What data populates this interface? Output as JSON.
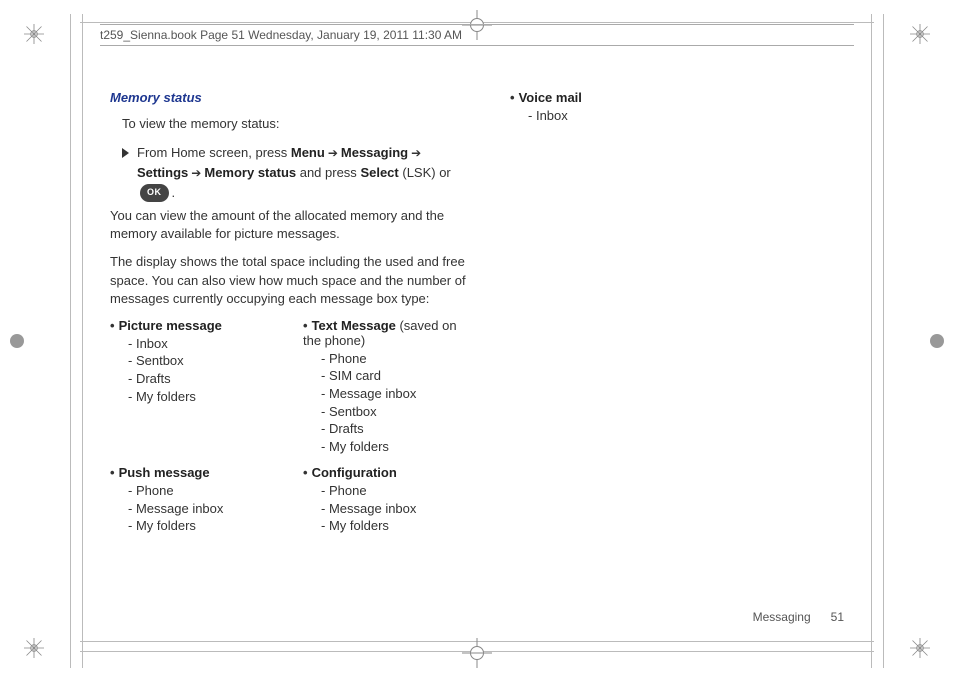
{
  "frame": {
    "header": "t259_Sienna.book  Page 51  Wednesday, January 19, 2011  11:30 AM"
  },
  "section": {
    "title": "Memory status",
    "intro": "To view the memory status:",
    "step": {
      "pre": "From Home screen, press ",
      "menu": "Menu",
      "arr": "➔",
      "messaging": "Messaging",
      "settings": "Settings",
      "memstatus": "Memory status",
      "and_press": " and press ",
      "select": "Select",
      "lsk": " (LSK) or ",
      "ok": "OK",
      "dot": "."
    },
    "para1": "You can view the amount of the allocated memory and the memory available for picture messages.",
    "para2": "The display shows the total space including the used and free space. You can also view how much space and the number of messages currently occupying each message box type:"
  },
  "lists": {
    "picture": {
      "title": "Picture message",
      "items": [
        "Inbox",
        "Sentbox",
        "Drafts",
        "My folders"
      ]
    },
    "text": {
      "title": "Text Message",
      "note": " (saved on the phone)",
      "items": [
        "Phone",
        "SIM card",
        "Message inbox",
        "Sentbox",
        "Drafts",
        "My folders"
      ]
    },
    "push": {
      "title": "Push message",
      "items": [
        "Phone",
        "Message inbox",
        "My folders"
      ]
    },
    "config": {
      "title": "Configuration",
      "items": [
        "Phone",
        "Message inbox",
        "My folders"
      ]
    },
    "voice": {
      "title": "Voice mail",
      "items": [
        "Inbox"
      ]
    }
  },
  "footer": {
    "section": "Messaging",
    "page": "51"
  }
}
